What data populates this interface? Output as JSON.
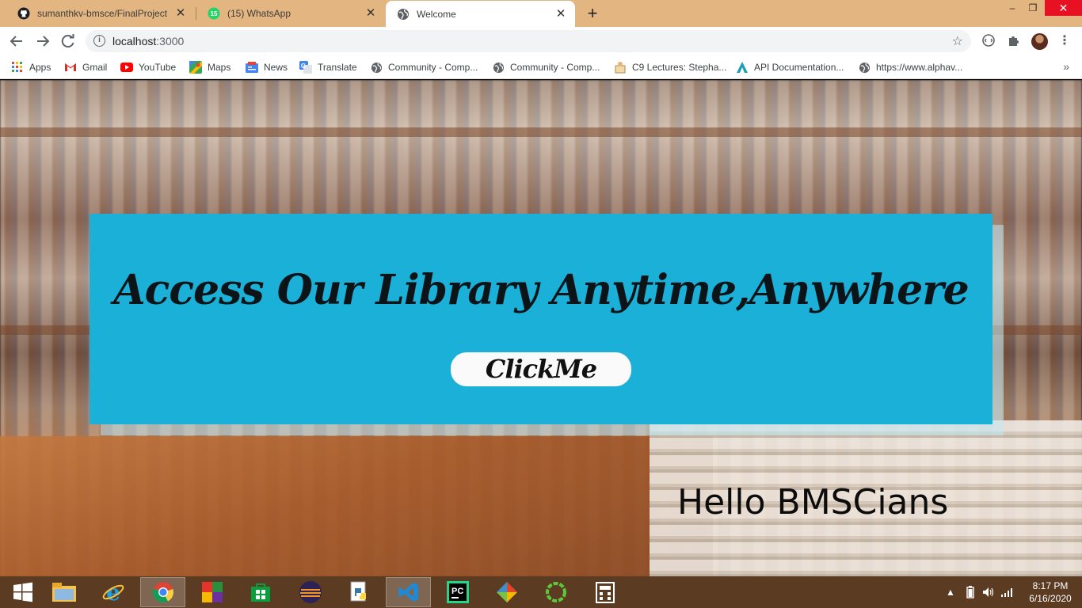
{
  "browser": {
    "tabs": [
      {
        "title": "sumanthkv-bmsce/FinalProject",
        "icon": "github-icon",
        "active": false
      },
      {
        "title": "(15) WhatsApp",
        "icon": "whatsapp-icon",
        "badge": "15",
        "active": false
      },
      {
        "title": "Welcome",
        "icon": "globe-icon",
        "active": true
      }
    ],
    "new_tab_symbol": "+",
    "window_controls": {
      "minimize": "–",
      "maximize": "❐",
      "close": "✕"
    },
    "url_host": "localhost",
    "url_port": ":3000"
  },
  "bookmarks": [
    {
      "label": "Apps",
      "icon": "apps-grid-icon"
    },
    {
      "label": "Gmail",
      "icon": "gmail-icon"
    },
    {
      "label": "YouTube",
      "icon": "youtube-icon"
    },
    {
      "label": "Maps",
      "icon": "maps-icon"
    },
    {
      "label": "News",
      "icon": "news-icon"
    },
    {
      "label": "Translate",
      "icon": "translate-icon"
    },
    {
      "label": "Community - Comp...",
      "icon": "globe-icon"
    },
    {
      "label": "Community - Comp...",
      "icon": "globe-icon"
    },
    {
      "label": "C9 Lectures: Stepha...",
      "icon": "c9-icon"
    },
    {
      "label": "API Documentation...",
      "icon": "api-icon"
    },
    {
      "label": "https://www.alphav...",
      "icon": "globe-icon"
    }
  ],
  "page": {
    "banner_title": "Access Our Library Anytime,Anywhere",
    "button_label": "ClickMe",
    "greeting": "Hello BMSCians",
    "banner_color": "#1ab0d8"
  },
  "taskbar": {
    "apps": [
      "start-icon",
      "file-explorer-icon",
      "internet-explorer-icon",
      "chrome-icon",
      "office-icon",
      "store-icon",
      "eclipse-icon",
      "python-icon",
      "vscode-icon",
      "pycharm-icon",
      "git-icon",
      "app-circle-icon",
      "calculator-icon"
    ],
    "time": "8:17 PM",
    "date": "6/16/2020"
  }
}
